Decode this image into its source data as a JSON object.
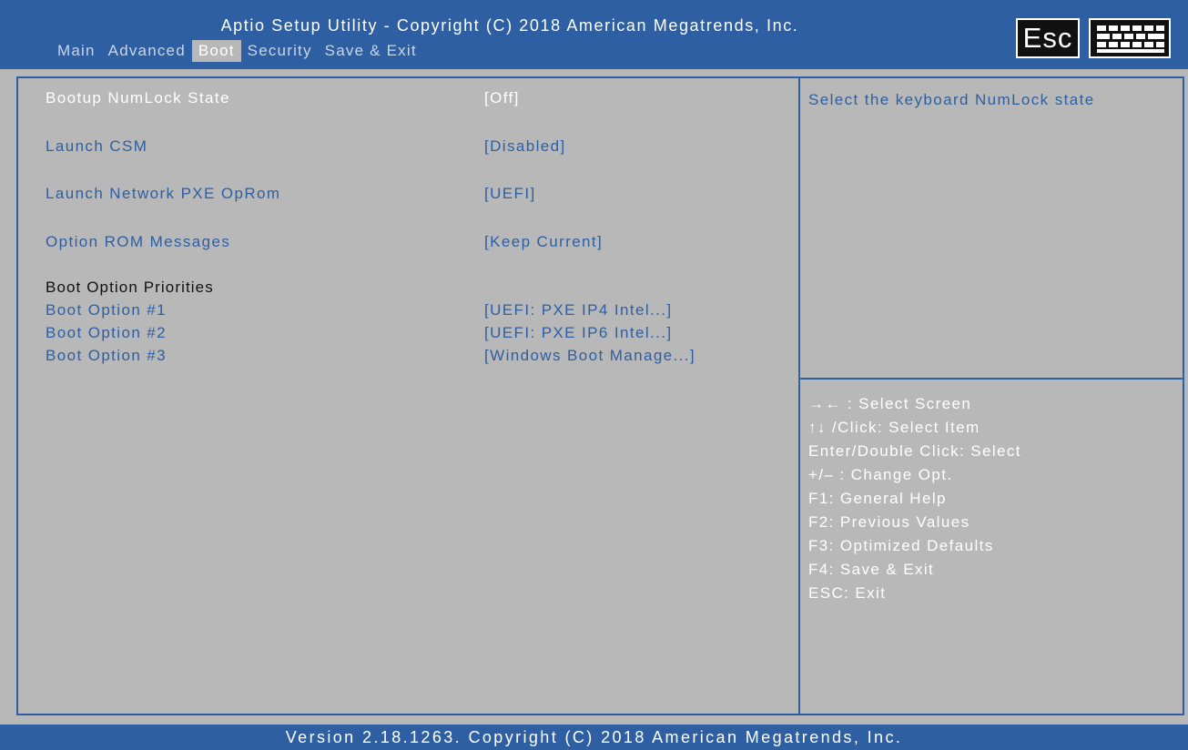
{
  "header": {
    "title": "Aptio Setup Utility - Copyright (C) 2018 American Megatrends, Inc.",
    "esc_label": "Esc",
    "tabs": [
      {
        "label": "Main",
        "active": false
      },
      {
        "label": "Advanced",
        "active": false
      },
      {
        "label": "Boot",
        "active": true
      },
      {
        "label": "Security",
        "active": false
      },
      {
        "label": "Save & Exit",
        "active": false
      }
    ]
  },
  "settings": [
    {
      "label": "Bootup NumLock State",
      "value": "[Off]",
      "selected": true
    },
    {
      "label": "Launch CSM",
      "value": "[Disabled]",
      "selected": false
    },
    {
      "label": "Launch Network PXE OpRom",
      "value": "[UEFI]",
      "selected": false
    },
    {
      "label": "Option ROM Messages",
      "value": "[Keep Current]",
      "selected": false
    }
  ],
  "boot_priorities": {
    "heading": "Boot Option Priorities",
    "options": [
      {
        "label": "Boot Option #1",
        "value": "[UEFI: PXE IP4 Intel...]"
      },
      {
        "label": "Boot Option #2",
        "value": "[UEFI: PXE IP6 Intel...]"
      },
      {
        "label": "Boot Option #3",
        "value": "[Windows Boot Manage...]"
      }
    ]
  },
  "help_text": "Select the keyboard NumLock state",
  "key_help": [
    "→← : Select Screen",
    "↑↓ /Click: Select Item",
    "Enter/Double Click: Select",
    "+/– : Change Opt.",
    "F1: General Help",
    "F2: Previous Values",
    "F3: Optimized Defaults",
    "F4: Save & Exit",
    "ESC: Exit"
  ],
  "footer": "Version 2.18.1263. Copyright (C) 2018 American Megatrends, Inc.",
  "colors": {
    "accent": "#2d5fa2",
    "background": "#b8b8b8",
    "selected_text": "#ffffff"
  }
}
